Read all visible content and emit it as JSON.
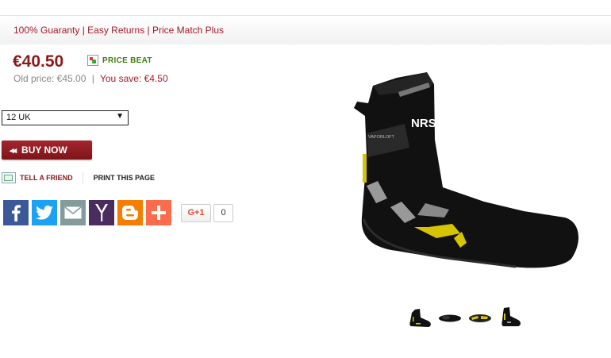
{
  "guarantee_bar": {
    "text": "100% Guaranty | Easy Returns | Price Match Plus"
  },
  "price": {
    "current": "€40.50",
    "old_label": "Old price: €45.00",
    "separator": "|",
    "save_label": "You save: €4.50"
  },
  "price_beat": {
    "label": "PRICE BEAT",
    "icon": "price-beat-icon"
  },
  "size_select": {
    "value": "12 UK",
    "arrow": "▼"
  },
  "buy_button": {
    "label": "BUY NOW"
  },
  "links": {
    "tell_friend": "TELL A FRIEND",
    "print_page": "PRINT THIS PAGE"
  },
  "share": {
    "buttons": [
      {
        "name": "facebook",
        "icon": "facebook-icon",
        "color": "#3b5998"
      },
      {
        "name": "twitter",
        "icon": "twitter-icon",
        "color": "#1da1f2"
      },
      {
        "name": "email",
        "icon": "email-icon",
        "color": "#849b9c"
      },
      {
        "name": "yahoo",
        "icon": "yahoo-icon",
        "color": "#4b2c5e"
      },
      {
        "name": "blogger",
        "icon": "blogger-icon",
        "color": "#f57d00"
      },
      {
        "name": "addthis",
        "icon": "plus-icon",
        "color": "#fa6c4b"
      }
    ],
    "gplus_label": "G+1",
    "gplus_count": "0"
  },
  "colors": {
    "brand_red": "#8b1a1a",
    "link_red": "#a31a2b",
    "price_beat_green": "#3e7e12"
  },
  "product": {
    "thumbnail_count": 4
  }
}
